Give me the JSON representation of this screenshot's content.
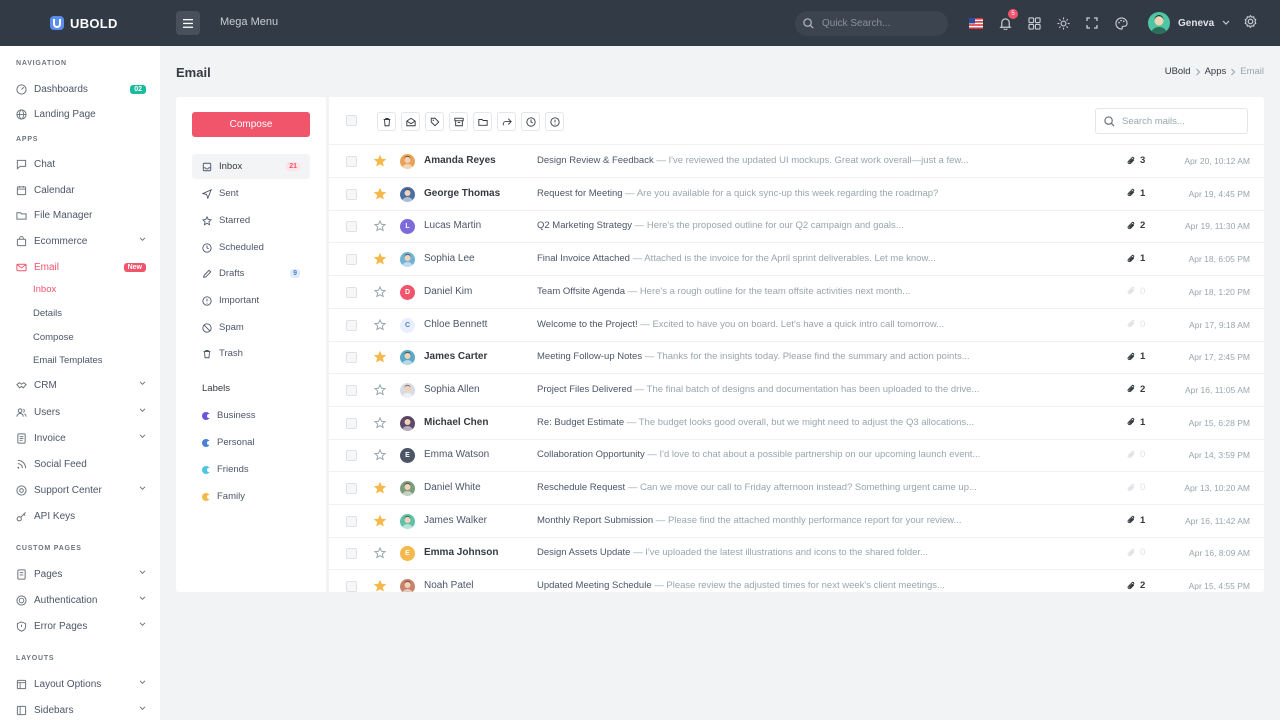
{
  "colors": {
    "accent": "#f1556c",
    "topbar": "#323a46",
    "success": "#1abc9c",
    "info": "#4a81d4",
    "star": "#f7b84b"
  },
  "topbar": {
    "brand": "UBOLD",
    "mega_menu": "Mega Menu",
    "search_placeholder": "Quick Search...",
    "notification_count": "5",
    "user_name": "Geneva"
  },
  "sidebar": {
    "sections": {
      "navigation": "NAVIGATION",
      "apps": "APPS",
      "custom_pages": "CUSTOM PAGES",
      "layouts": "LAYOUTS"
    },
    "dashboards": {
      "label": "Dashboards",
      "badge": "02"
    },
    "landing": "Landing Page",
    "chat": "Chat",
    "calendar": "Calendar",
    "file_manager": "File Manager",
    "ecommerce": "Ecommerce",
    "email": {
      "label": "Email",
      "badge": "New"
    },
    "email_sub": [
      "Inbox",
      "Details",
      "Compose",
      "Email Templates"
    ],
    "crm": "CRM",
    "users": "Users",
    "invoice": "Invoice",
    "social_feed": "Social Feed",
    "support_center": "Support Center",
    "api_keys": "API Keys",
    "pages": "Pages",
    "authentication": "Authentication",
    "error_pages": "Error Pages",
    "layout_options": "Layout Options",
    "sidebars": "Sidebars"
  },
  "page": {
    "title": "Email",
    "breadcrumb": [
      "UBold",
      "Apps",
      "Email"
    ]
  },
  "folders": {
    "compose": "Compose",
    "items": [
      {
        "label": "Inbox",
        "count": "21"
      },
      {
        "label": "Sent",
        "count": ""
      },
      {
        "label": "Starred",
        "count": ""
      },
      {
        "label": "Scheduled",
        "count": ""
      },
      {
        "label": "Drafts",
        "count": "9"
      },
      {
        "label": "Important",
        "count": ""
      },
      {
        "label": "Spam",
        "count": ""
      },
      {
        "label": "Trash",
        "count": ""
      }
    ],
    "labels_title": "Labels",
    "labels": [
      {
        "label": "Business",
        "color": "#6658dd"
      },
      {
        "label": "Personal",
        "color": "#4a81d4"
      },
      {
        "label": "Friends",
        "color": "#4fc6e1"
      },
      {
        "label": "Family",
        "color": "#f7b84b"
      }
    ]
  },
  "mail": {
    "search_placeholder": "Search mails...",
    "rows": [
      {
        "sender": "Amanda Reyes",
        "subject": "Design Review & Feedback",
        "preview": "I've reviewed the updated UI mockups. Great work overall—just a few...",
        "attachments": "3",
        "date": "Apr 20, 10:12 AM",
        "starred": true,
        "unread": true,
        "avatar_color": "#e8a35b",
        "initial": ""
      },
      {
        "sender": "George Thomas",
        "subject": "Request for Meeting",
        "preview": "Are you available for a quick sync-up this week regarding the roadmap?",
        "attachments": "1",
        "date": "Apr 19, 4:45 PM",
        "starred": true,
        "unread": true,
        "avatar_color": "#4a6fa5",
        "initial": ""
      },
      {
        "sender": "Lucas Martin",
        "subject": "Q2 Marketing Strategy",
        "preview": "Here's the proposed outline for our Q2 campaign and goals...",
        "attachments": "2",
        "date": "Apr 19, 11:30 AM",
        "starred": false,
        "unread": false,
        "avatar_color": "#7e6bdb",
        "initial": "L"
      },
      {
        "sender": "Sophia Lee",
        "subject": "Final Invoice Attached",
        "preview": "Attached is the invoice for the April sprint deliverables. Let me know...",
        "attachments": "1",
        "date": "Apr 18, 6:05 PM",
        "starred": true,
        "unread": false,
        "avatar_color": "#6fb3d6",
        "initial": ""
      },
      {
        "sender": "Daniel Kim",
        "subject": "Team Offsite Agenda",
        "preview": "Here's a rough outline for the team offsite activities next month...",
        "attachments": "0",
        "date": "Apr 18, 1:20 PM",
        "starred": false,
        "unread": false,
        "avatar_color": "#f1556c",
        "initial": "D"
      },
      {
        "sender": "Chloe Bennett",
        "subject": "Welcome to the Project!",
        "preview": "Excited to have you on board. Let's have a quick intro call tomorrow...",
        "attachments": "0",
        "date": "Apr 17, 9:18 AM",
        "starred": false,
        "unread": false,
        "avatar_color": "#e9effb",
        "initial": "C"
      },
      {
        "sender": "James Carter",
        "subject": "Meeting Follow-up Notes",
        "preview": "Thanks for the insights today. Please find the summary and action points...",
        "attachments": "1",
        "date": "Apr 17, 2:45 PM",
        "starred": true,
        "unread": true,
        "avatar_color": "#5aa9c9",
        "initial": ""
      },
      {
        "sender": "Sophia Allen",
        "subject": "Project Files Delivered",
        "preview": "The final batch of designs and documentation has been uploaded to the drive...",
        "attachments": "2",
        "date": "Apr 16, 11:05 AM",
        "starred": false,
        "unread": false,
        "avatar_color": "#d9dde3",
        "initial": ""
      },
      {
        "sender": "Michael Chen",
        "subject": "Re: Budget Estimate",
        "preview": "The budget looks good overall, but we might need to adjust the Q3 allocations...",
        "attachments": "1",
        "date": "Apr 15, 6:28 PM",
        "starred": false,
        "unread": true,
        "avatar_color": "#5d4a6b",
        "initial": ""
      },
      {
        "sender": "Emma Watson",
        "subject": "Collaboration Opportunity",
        "preview": "I'd love to chat about a possible partnership on our upcoming launch event...",
        "attachments": "0",
        "date": "Apr 14, 3:59 PM",
        "starred": false,
        "unread": false,
        "avatar_color": "#4c5667",
        "initial": "E"
      },
      {
        "sender": "Daniel White",
        "subject": "Reschedule Request",
        "preview": "Can we move our call to Friday afternoon instead? Something urgent came up...",
        "attachments": "0",
        "date": "Apr 13, 10:20 AM",
        "starred": true,
        "unread": false,
        "avatar_color": "#7d9c7b",
        "initial": ""
      },
      {
        "sender": "James Walker",
        "subject": "Monthly Report Submission",
        "preview": "Please find the attached monthly performance report for your review...",
        "attachments": "1",
        "date": "Apr 16, 11:42 AM",
        "starred": true,
        "unread": false,
        "avatar_color": "#5fc1a8",
        "initial": ""
      },
      {
        "sender": "Emma Johnson",
        "subject": "Design Assets Update",
        "preview": "I've uploaded the latest illustrations and icons to the shared folder...",
        "attachments": "0",
        "date": "Apr 16, 8:09 AM",
        "starred": false,
        "unread": true,
        "avatar_color": "#f7b84b",
        "initial": "E"
      },
      {
        "sender": "Noah Patel",
        "subject": "Updated Meeting Schedule",
        "preview": "Please review the adjusted times for next week's client meetings...",
        "attachments": "2",
        "date": "Apr 15, 4:55 PM",
        "starred": true,
        "unread": false,
        "avatar_color": "#c9826b",
        "initial": ""
      }
    ]
  }
}
